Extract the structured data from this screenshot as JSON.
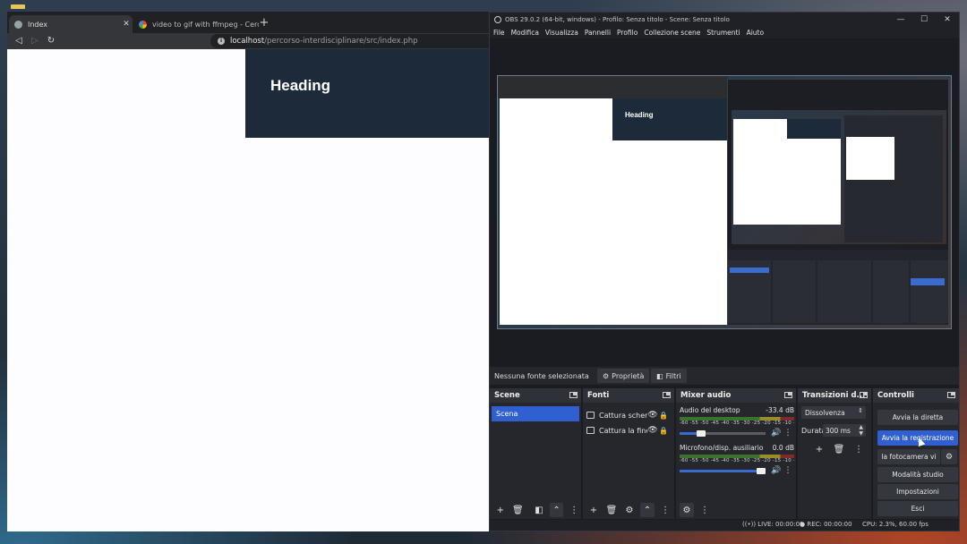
{
  "browser": {
    "tabs": [
      {
        "title": "Index",
        "close": "✕"
      },
      {
        "title": "video to gif with ffmpeg - Cerca con G",
        "close": ""
      }
    ],
    "new_tab": "+",
    "nav": {
      "back": "◁",
      "forward": "▷",
      "reload": "↻"
    },
    "url_host": "localhost",
    "url_path": "/percorso-interdisciplinare/src/index.php",
    "page": {
      "heading": "Heading"
    }
  },
  "obs": {
    "title": "OBS 29.0.2 (64-bit, windows) - Profilo: Senza titolo - Scene: Senza titolo",
    "window_controls": {
      "minimize": "—",
      "maximize": "☐",
      "close": "✕"
    },
    "menu": [
      "File",
      "Modifica",
      "Visualizza",
      "Pannelli",
      "Profilo",
      "Collezione scene",
      "Strumenti",
      "Aiuto"
    ],
    "preview_heading": "Heading",
    "source_bar": {
      "status": "Nessuna fonte selezionata",
      "properties": "Proprietà",
      "filters": "Filtri"
    },
    "docks": {
      "scenes": {
        "title": "Scene",
        "items": [
          "Scena"
        ]
      },
      "sources": {
        "title": "Fonti",
        "items": [
          "Cattura scher",
          "Cattura la fine"
        ]
      },
      "mixer": {
        "title": "Mixer audio",
        "scale": "-60 -55 -50 -45 -40 -35 -30 -25 -20 -15 -10 -5 0",
        "channels": [
          {
            "name": "Audio del desktop",
            "level": "-33.4 dB",
            "volume": 0.22
          },
          {
            "name": "Microfono/disp. ausiliario",
            "level": "0.0 dB",
            "volume": 1.0
          }
        ]
      },
      "transitions": {
        "title": "Transizioni d...",
        "selected": "Dissolvenza",
        "duration_label": "Durata",
        "duration": "300 ms"
      },
      "controls": {
        "title": "Controlli",
        "buttons": {
          "stream": "Avvia la diretta",
          "record": "Avvia la registrazione",
          "virtual_cam": "la fotocamera vi",
          "studio": "Modalità studio",
          "settings": "Impostazioni",
          "exit": "Esci"
        }
      }
    },
    "status": {
      "live": "LIVE: 00:00:00",
      "rec": "REC: 00:00:00",
      "cpu": "CPU: 2.3%, 60.00 fps"
    }
  },
  "colors": {
    "accent": "#2f5fd0",
    "page_header": "#1c2a3a",
    "obs_bg": "#1a1c22"
  }
}
